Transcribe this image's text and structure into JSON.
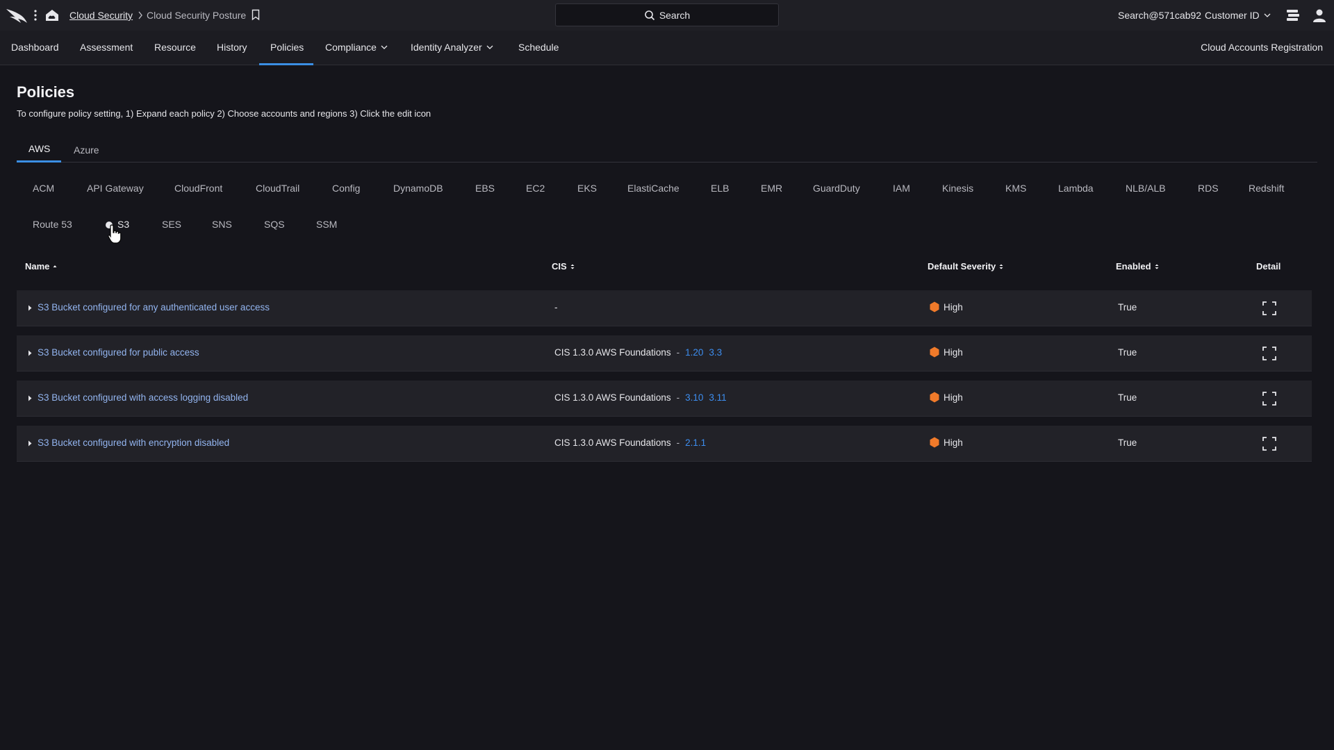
{
  "topbar": {
    "breadcrumb_link": "Cloud Security",
    "breadcrumb_current": "Cloud Security Posture",
    "search_label": "Search",
    "user": "Search@571cab92",
    "customer_id": "Customer ID"
  },
  "nav": {
    "items": [
      "Dashboard",
      "Assessment",
      "Resource",
      "History",
      "Policies",
      "Compliance",
      "Identity Analyzer",
      "Schedule"
    ],
    "active": "Policies",
    "right_link": "Cloud Accounts Registration"
  },
  "page": {
    "title": "Policies",
    "description": "To configure policy setting, 1) Expand each policy 2) Choose accounts and regions 3) Click the edit icon"
  },
  "cloud_tabs": [
    "AWS",
    "Azure"
  ],
  "active_cloud_tab": "AWS",
  "services_row1": [
    "ACM",
    "API Gateway",
    "CloudFront",
    "CloudTrail",
    "Config",
    "DynamoDB",
    "EBS",
    "EC2",
    "EKS",
    "ElastiCache",
    "ELB",
    "EMR",
    "GuardDuty",
    "IAM",
    "Kinesis",
    "KMS",
    "Lambda",
    "NLB/ALB",
    "RDS",
    "Redshift"
  ],
  "services_row2": [
    "Route 53",
    "S3",
    "SES",
    "SNS",
    "SQS",
    "SSM"
  ],
  "selected_service": "S3",
  "table": {
    "headers": {
      "name": "Name",
      "cis": "CIS",
      "severity": "Default Severity",
      "enabled": "Enabled",
      "detail": "Detail"
    },
    "rows": [
      {
        "name": "S3 Bucket configured for any authenticated user access",
        "cis_text": "-",
        "cis_links": [],
        "severity": "High",
        "enabled": "True"
      },
      {
        "name": "S3 Bucket configured for public access",
        "cis_text": "CIS 1.3.0 AWS Foundations",
        "cis_links": [
          "1.20",
          "3.3"
        ],
        "severity": "High",
        "enabled": "True"
      },
      {
        "name": "S3 Bucket configured with access logging disabled",
        "cis_text": "CIS 1.3.0 AWS Foundations",
        "cis_links": [
          "3.10",
          "3.11"
        ],
        "severity": "High",
        "enabled": "True"
      },
      {
        "name": "S3 Bucket configured with encryption disabled",
        "cis_text": "CIS 1.3.0 AWS Foundations",
        "cis_links": [
          "2.1.1"
        ],
        "severity": "High",
        "enabled": "True"
      }
    ]
  },
  "colors": {
    "accent": "#3b8fe4",
    "severity_high": "#f07a2a",
    "background": "#15151b"
  }
}
